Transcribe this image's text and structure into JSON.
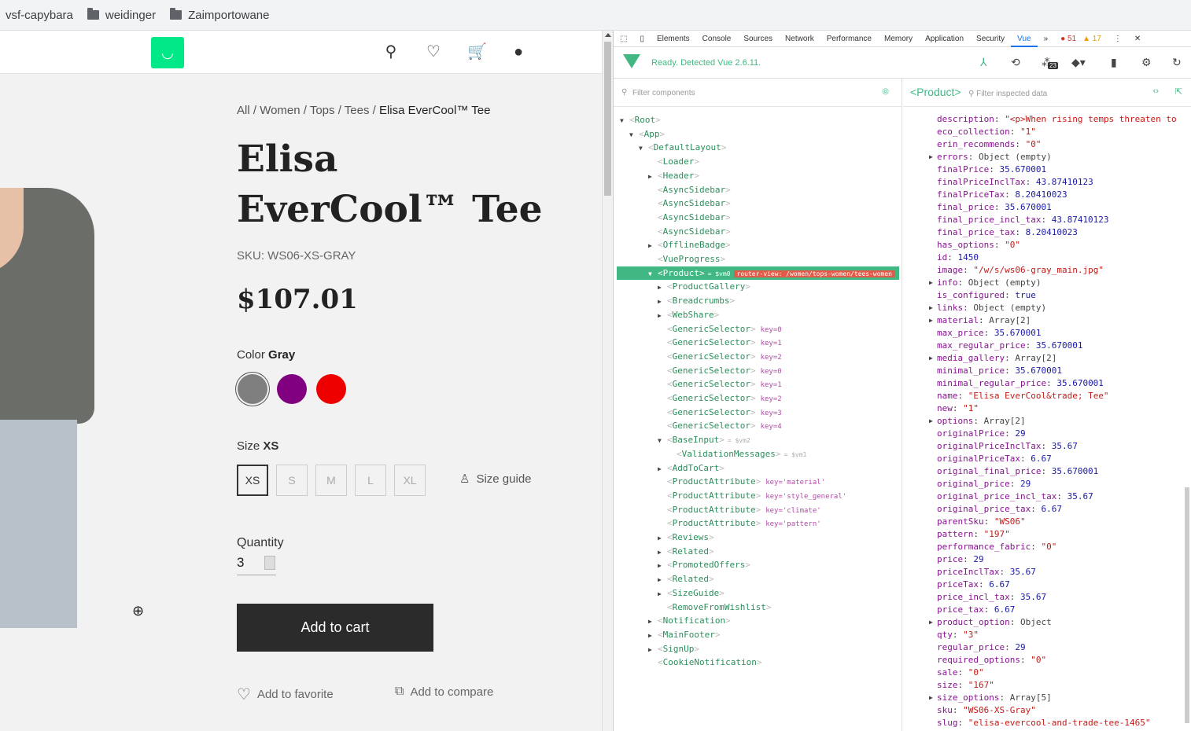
{
  "bookmarks": {
    "b1": "vsf-capybara",
    "b2": "weidinger",
    "b3": "Zaimportowane"
  },
  "breadcrumb": {
    "all": "All",
    "women": "Women",
    "tops": "Tops",
    "tees": "Tees",
    "current": "Elisa EverCool™ Tee"
  },
  "product": {
    "title": "Elisa EverCool™ Tee",
    "sku": "SKU: WS06-XS-GRAY",
    "price": "$107.01",
    "color_label": "Color",
    "color_value": "Gray",
    "colors": [
      "#7f7f7f",
      "#800080",
      "#ee0000"
    ],
    "size_label": "Size",
    "size_value": "XS",
    "sizes": [
      "XS",
      "S",
      "M",
      "L",
      "XL"
    ],
    "size_guide": "Size guide",
    "quantity_label": "Quantity",
    "quantity": "3",
    "add_to_cart": "Add to cart",
    "add_favorite": "Add to favorite",
    "add_compare": "Add to compare"
  },
  "devtools": {
    "tabs": [
      "Elements",
      "Console",
      "Sources",
      "Network",
      "Performance",
      "Memory",
      "Application",
      "Security",
      "Vue"
    ],
    "errors": "51",
    "warnings": "17",
    "ready": "Ready. Detected Vue 2.6.11.",
    "filter_components": "Filter components",
    "inspected": "<Product>",
    "filter_data": "Filter inspected data",
    "badge": "23",
    "tree": [
      {
        "t": "▼",
        "n": "Root",
        "d": 0
      },
      {
        "t": "▼",
        "n": "App",
        "d": 1
      },
      {
        "t": "▼",
        "n": "DefaultLayout",
        "d": 2
      },
      {
        "t": "",
        "n": "Loader",
        "d": 3
      },
      {
        "t": "▶",
        "n": "Header",
        "d": 3
      },
      {
        "t": "",
        "n": "AsyncSidebar",
        "d": 3
      },
      {
        "t": "",
        "n": "AsyncSidebar",
        "d": 3
      },
      {
        "t": "",
        "n": "AsyncSidebar",
        "d": 3
      },
      {
        "t": "",
        "n": "AsyncSidebar",
        "d": 3
      },
      {
        "t": "▶",
        "n": "OfflineBadge",
        "d": 3
      },
      {
        "t": "",
        "n": "VueProgress",
        "d": 3
      },
      {
        "t": "▼",
        "n": "Product",
        "d": 3,
        "hl": true,
        "extra": "= $vm0",
        "route": "router-view: /women/tops-women/tees-women"
      },
      {
        "t": "▶",
        "n": "ProductGallery",
        "d": 4
      },
      {
        "t": "▶",
        "n": "Breadcrumbs",
        "d": 4
      },
      {
        "t": "▶",
        "n": "WebShare",
        "d": 4
      },
      {
        "t": "",
        "n": "GenericSelector",
        "d": 4,
        "key": "key=0"
      },
      {
        "t": "",
        "n": "GenericSelector",
        "d": 4,
        "key": "key=1"
      },
      {
        "t": "",
        "n": "GenericSelector",
        "d": 4,
        "key": "key=2"
      },
      {
        "t": "",
        "n": "GenericSelector",
        "d": 4,
        "key": "key=0"
      },
      {
        "t": "",
        "n": "GenericSelector",
        "d": 4,
        "key": "key=1"
      },
      {
        "t": "",
        "n": "GenericSelector",
        "d": 4,
        "key": "key=2"
      },
      {
        "t": "",
        "n": "GenericSelector",
        "d": 4,
        "key": "key=3"
      },
      {
        "t": "",
        "n": "GenericSelector",
        "d": 4,
        "key": "key=4"
      },
      {
        "t": "▼",
        "n": "BaseInput",
        "d": 4,
        "extra": "= $vm2"
      },
      {
        "t": "",
        "n": "ValidationMessages",
        "d": 5,
        "extra": "= $vm1"
      },
      {
        "t": "▶",
        "n": "AddToCart",
        "d": 4
      },
      {
        "t": "",
        "n": "ProductAttribute",
        "d": 4,
        "key": "key='material'"
      },
      {
        "t": "",
        "n": "ProductAttribute",
        "d": 4,
        "key": "key='style_general'"
      },
      {
        "t": "",
        "n": "ProductAttribute",
        "d": 4,
        "key": "key='climate'"
      },
      {
        "t": "",
        "n": "ProductAttribute",
        "d": 4,
        "key": "key='pattern'"
      },
      {
        "t": "▶",
        "n": "Reviews",
        "d": 4
      },
      {
        "t": "▶",
        "n": "Related",
        "d": 4
      },
      {
        "t": "▶",
        "n": "PromotedOffers",
        "d": 4
      },
      {
        "t": "▶",
        "n": "Related",
        "d": 4
      },
      {
        "t": "▶",
        "n": "SizeGuide",
        "d": 4
      },
      {
        "t": "",
        "n": "RemoveFromWishlist",
        "d": 4
      },
      {
        "t": "▶",
        "n": "Notification",
        "d": 3
      },
      {
        "t": "▶",
        "n": "MainFooter",
        "d": 3
      },
      {
        "t": "▶",
        "n": "SignUp",
        "d": 3
      },
      {
        "t": "",
        "n": "CookieNotification",
        "d": 3
      }
    ],
    "props": [
      {
        "k": "description",
        "v": "\"<p>When rising temps threaten to",
        "s": "s"
      },
      {
        "k": "eco_collection",
        "v": "\"1\"",
        "s": "s"
      },
      {
        "k": "erin_recommends",
        "v": "\"0\"",
        "s": "s"
      },
      {
        "k": "errors",
        "v": "Object (empty)",
        "s": "o",
        "tri": true
      },
      {
        "k": "finalPrice",
        "v": "35.670001",
        "s": "v"
      },
      {
        "k": "finalPriceInclTax",
        "v": "43.87410123",
        "s": "v"
      },
      {
        "k": "finalPriceTax",
        "v": "8.20410023",
        "s": "v"
      },
      {
        "k": "final_price",
        "v": "35.670001",
        "s": "v"
      },
      {
        "k": "final_price_incl_tax",
        "v": "43.87410123",
        "s": "v"
      },
      {
        "k": "final_price_tax",
        "v": "8.20410023",
        "s": "v"
      },
      {
        "k": "has_options",
        "v": "\"0\"",
        "s": "s"
      },
      {
        "k": "id",
        "v": "1450",
        "s": "v"
      },
      {
        "k": "image",
        "v": "\"/w/s/ws06-gray_main.jpg\"",
        "s": "s"
      },
      {
        "k": "info",
        "v": "Object (empty)",
        "s": "o",
        "tri": true
      },
      {
        "k": "is_configured",
        "v": "true",
        "s": "v"
      },
      {
        "k": "links",
        "v": "Object (empty)",
        "s": "o",
        "tri": true
      },
      {
        "k": "material",
        "v": "Array[2]",
        "s": "o",
        "tri": true
      },
      {
        "k": "max_price",
        "v": "35.670001",
        "s": "v"
      },
      {
        "k": "max_regular_price",
        "v": "35.670001",
        "s": "v"
      },
      {
        "k": "media_gallery",
        "v": "Array[2]",
        "s": "o",
        "tri": true
      },
      {
        "k": "minimal_price",
        "v": "35.670001",
        "s": "v"
      },
      {
        "k": "minimal_regular_price",
        "v": "35.670001",
        "s": "v"
      },
      {
        "k": "name",
        "v": "\"Elisa EverCool&trade; Tee\"",
        "s": "s"
      },
      {
        "k": "new",
        "v": "\"1\"",
        "s": "s"
      },
      {
        "k": "options",
        "v": "Array[2]",
        "s": "o",
        "tri": true
      },
      {
        "k": "originalPrice",
        "v": "29",
        "s": "v"
      },
      {
        "k": "originalPriceInclTax",
        "v": "35.67",
        "s": "v"
      },
      {
        "k": "originalPriceTax",
        "v": "6.67",
        "s": "v"
      },
      {
        "k": "original_final_price",
        "v": "35.670001",
        "s": "v"
      },
      {
        "k": "original_price",
        "v": "29",
        "s": "v"
      },
      {
        "k": "original_price_incl_tax",
        "v": "35.67",
        "s": "v"
      },
      {
        "k": "original_price_tax",
        "v": "6.67",
        "s": "v"
      },
      {
        "k": "parentSku",
        "v": "\"WS06\"",
        "s": "s"
      },
      {
        "k": "pattern",
        "v": "\"197\"",
        "s": "s"
      },
      {
        "k": "performance_fabric",
        "v": "\"0\"",
        "s": "s"
      },
      {
        "k": "price",
        "v": "29",
        "s": "v"
      },
      {
        "k": "priceInclTax",
        "v": "35.67",
        "s": "v"
      },
      {
        "k": "priceTax",
        "v": "6.67",
        "s": "v"
      },
      {
        "k": "price_incl_tax",
        "v": "35.67",
        "s": "v"
      },
      {
        "k": "price_tax",
        "v": "6.67",
        "s": "v"
      },
      {
        "k": "product_option",
        "v": "Object",
        "s": "o",
        "tri": true
      },
      {
        "k": "qty",
        "v": "\"3\"",
        "s": "s"
      },
      {
        "k": "regular_price",
        "v": "29",
        "s": "v"
      },
      {
        "k": "required_options",
        "v": "\"0\"",
        "s": "s"
      },
      {
        "k": "sale",
        "v": "\"0\"",
        "s": "s"
      },
      {
        "k": "size",
        "v": "\"167\"",
        "s": "s"
      },
      {
        "k": "size_options",
        "v": "Array[5]",
        "s": "o",
        "tri": true
      },
      {
        "k": "sku",
        "v": "\"WS06-XS-Gray\"",
        "s": "s"
      },
      {
        "k": "slug",
        "v": "\"elisa-evercool-and-trade-tee-1465\"",
        "s": "s"
      }
    ]
  }
}
